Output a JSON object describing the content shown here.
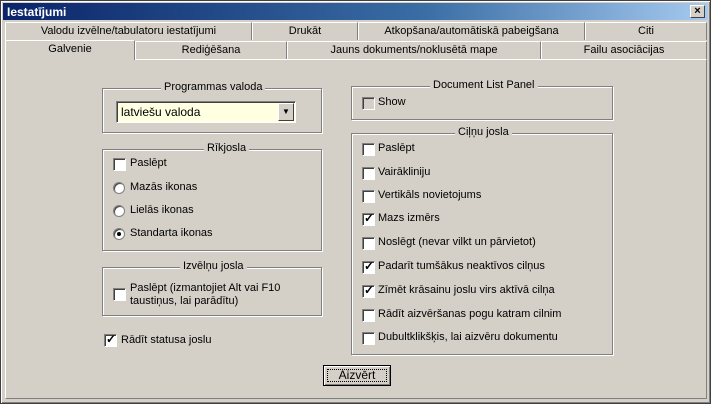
{
  "window": {
    "title": "Iestatījumi",
    "close_label": "×"
  },
  "tabs_row1": [
    {
      "label": "Valodu izvēlne/tabulatoru iestatījumi"
    },
    {
      "label": "Drukāt"
    },
    {
      "label": "Atkopšana/automātiskā pabeigšana"
    },
    {
      "label": "Citi"
    }
  ],
  "tabs_row2": [
    {
      "label": "Galvenie"
    },
    {
      "label": "Rediģēšana"
    },
    {
      "label": "Jauns dokuments/noklusētā mape"
    },
    {
      "label": "Failu asociācijas"
    }
  ],
  "program_language": {
    "legend": "Programmas valoda",
    "selected": "latviešu valoda"
  },
  "toolbar": {
    "legend": "Rīkjosla",
    "hide_label": "Paslēpt",
    "options": [
      "Mazās ikonas",
      "Lielās ikonas",
      "Standarta ikonas"
    ],
    "selected_index": 2
  },
  "menubar": {
    "legend": "Izvēlņu josla",
    "hide_label_line1": "Paslēpt (izmantojiet Alt vai F10",
    "hide_label_line2": "taustiņus, lai parādītu)"
  },
  "statusbar": {
    "label": "Rādīt statusa joslu",
    "checked": true
  },
  "doc_list_panel": {
    "legend": "Document List Panel",
    "show_label": "Show"
  },
  "tabbar": {
    "legend": "Ciļņu josla",
    "items": [
      {
        "label": "Paslēpt",
        "checked": false
      },
      {
        "label": "Vairākliniju",
        "checked": false
      },
      {
        "label": "Vertikāls novietojums",
        "checked": false
      },
      {
        "label": "Mazs izmērs",
        "checked": true
      },
      {
        "label": "Noslēgt (nevar vilkt un pārvietot)",
        "checked": false
      },
      {
        "label": "Padarīt tumšākus neaktīvos cilņus",
        "checked": true
      },
      {
        "label": "Zīmēt krāsainu joslu virs aktīvā cilņa",
        "checked": true
      },
      {
        "label": "Rādīt aizvēršanas pogu katram cilnim",
        "checked": false
      },
      {
        "label": "Dubultklikšķis, lai aizvēru dokumentu",
        "checked": false
      }
    ]
  },
  "close_button": {
    "label": "Aizvērt"
  }
}
